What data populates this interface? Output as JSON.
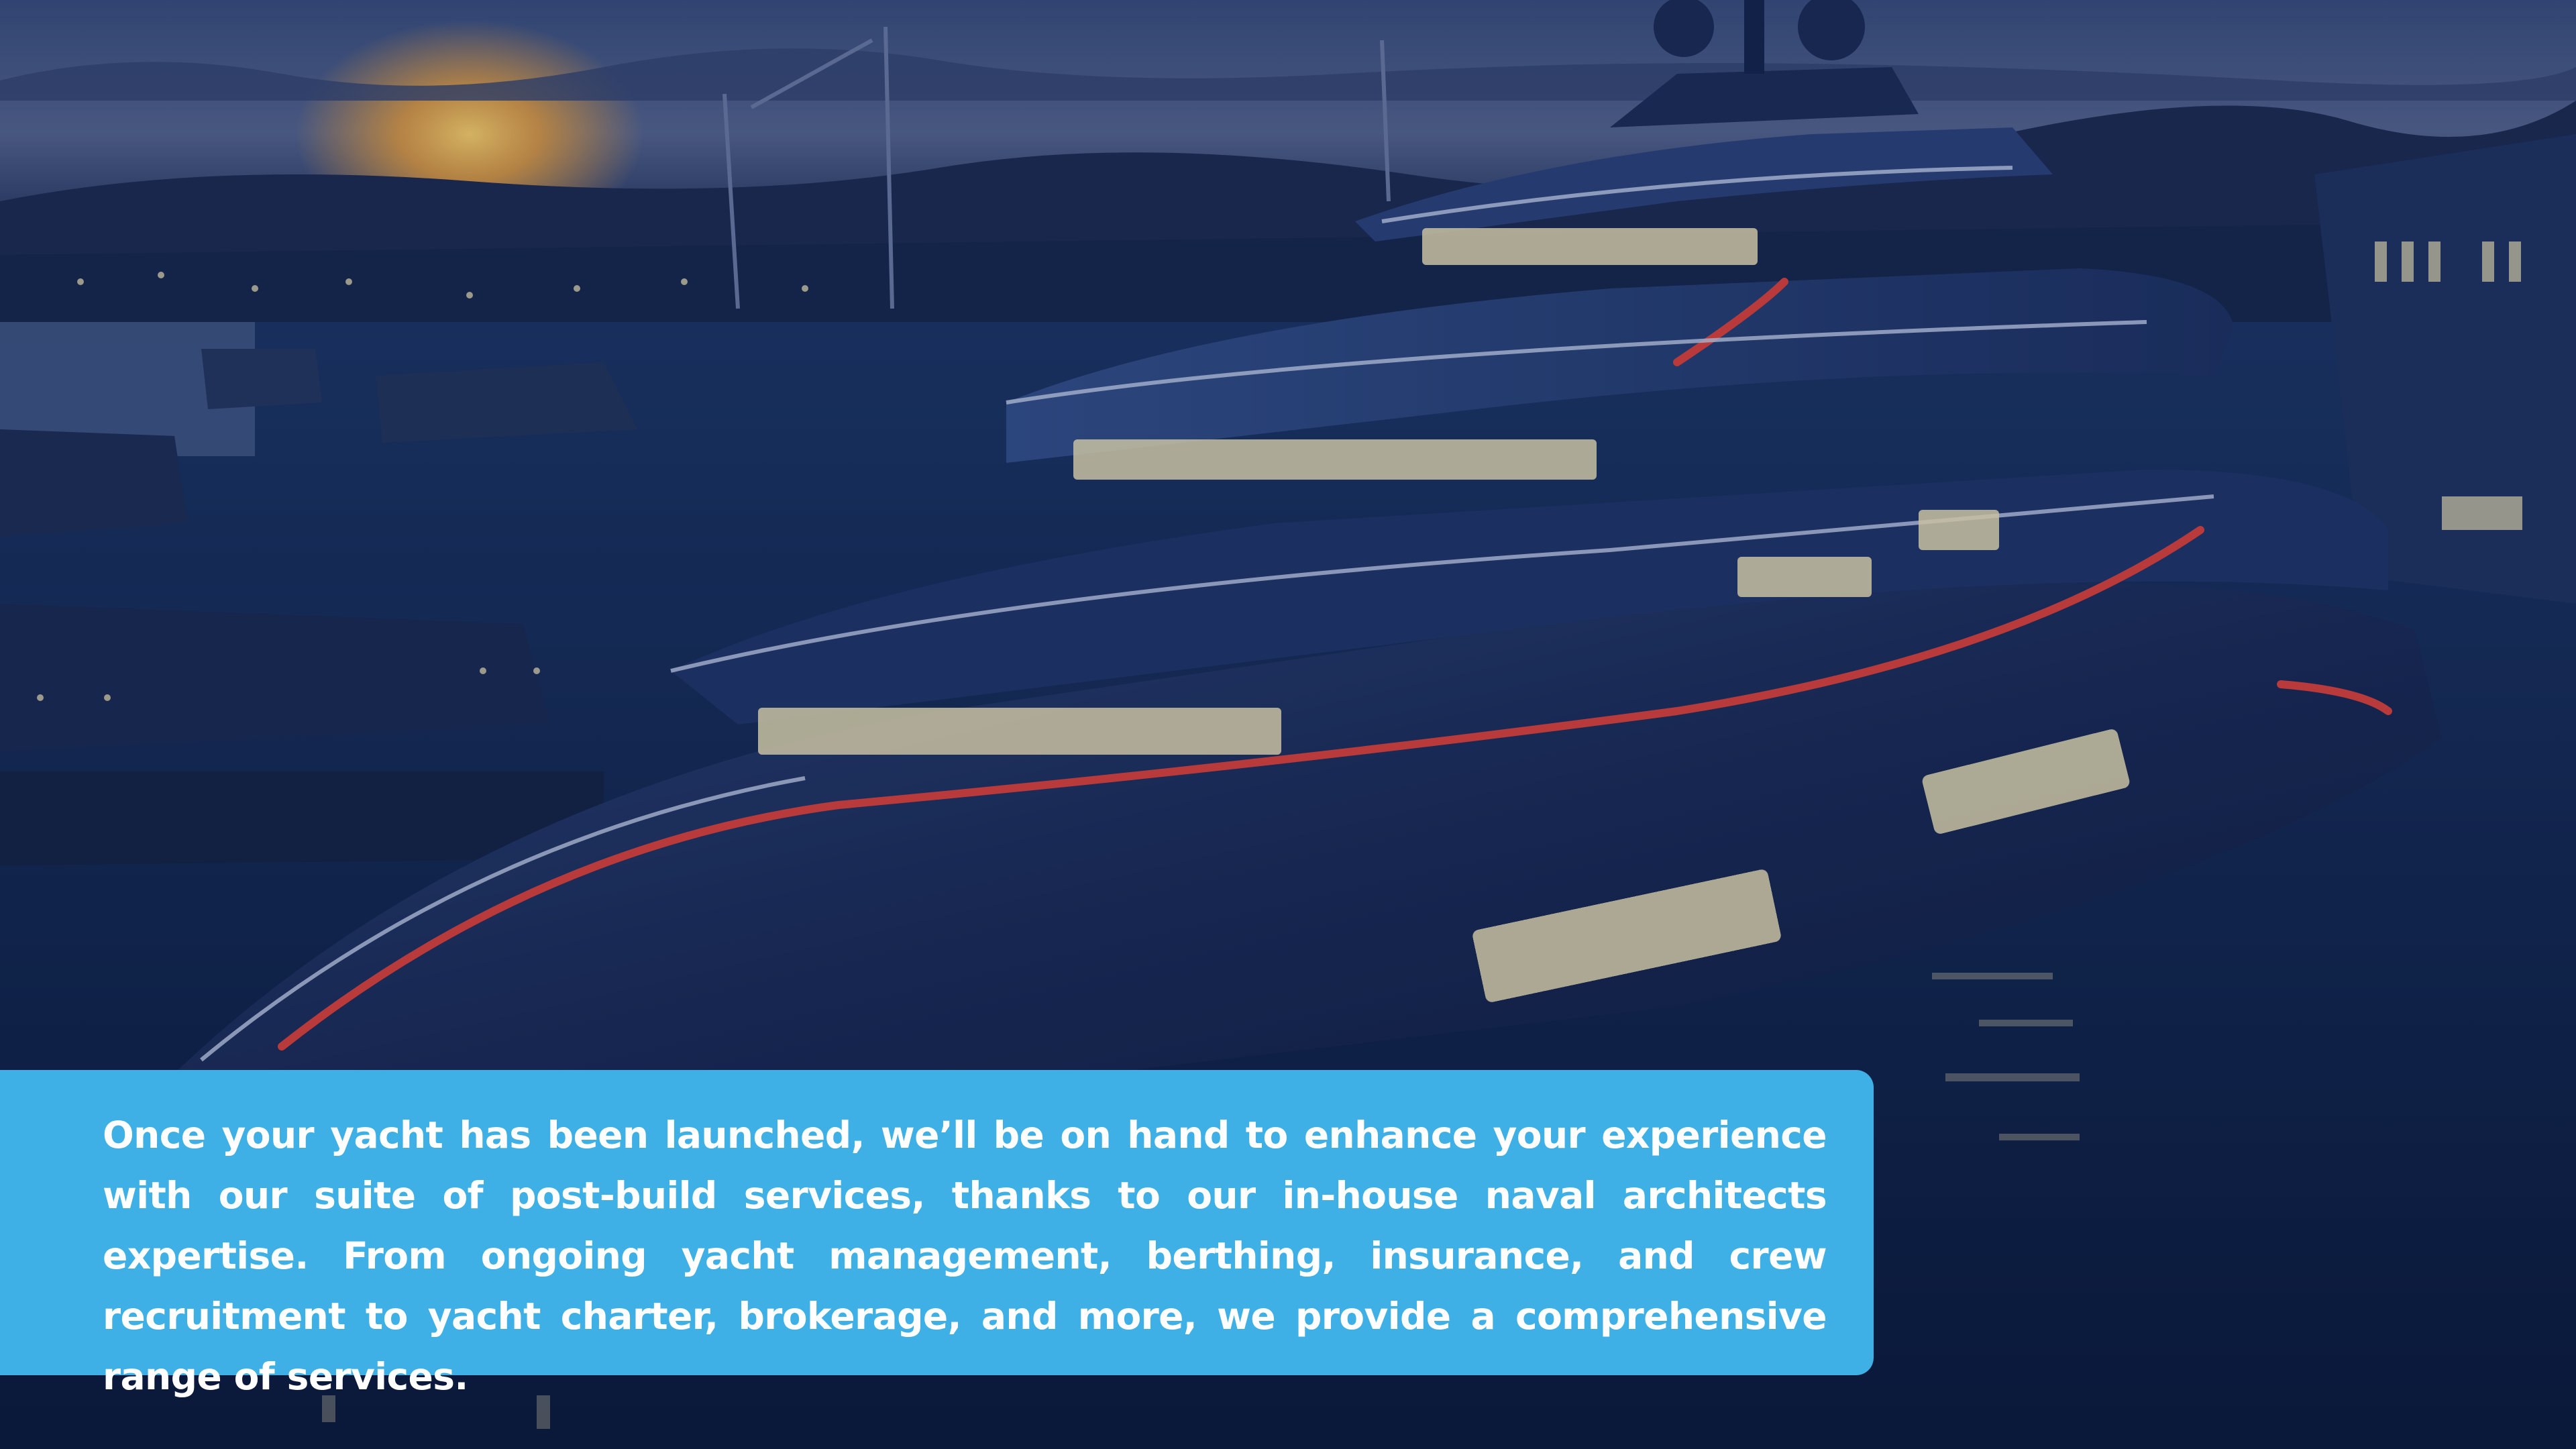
{
  "card": {
    "text": "Once your yacht has been launched, we’ll be on hand to enhance your experience with our suite of post-build services, thanks to our in-house naval architects expertise. From ongoing yacht management, berthing, insurance, and crew recruitment to yacht charter, brokerage, and more, we provide a comprehensive range of services.",
    "background_color": "#3fb0e6",
    "text_color": "#ffffff"
  },
  "background": {
    "image": "superyacht-at-dusk-photo",
    "sky_color": "#4a5f8c",
    "sunset_color": "#f2a43a",
    "water_color": "#10254d",
    "hull_color": "#1c2f5e",
    "accent_line_color": "#e0413a",
    "window_light_color": "#f3e6b8"
  }
}
